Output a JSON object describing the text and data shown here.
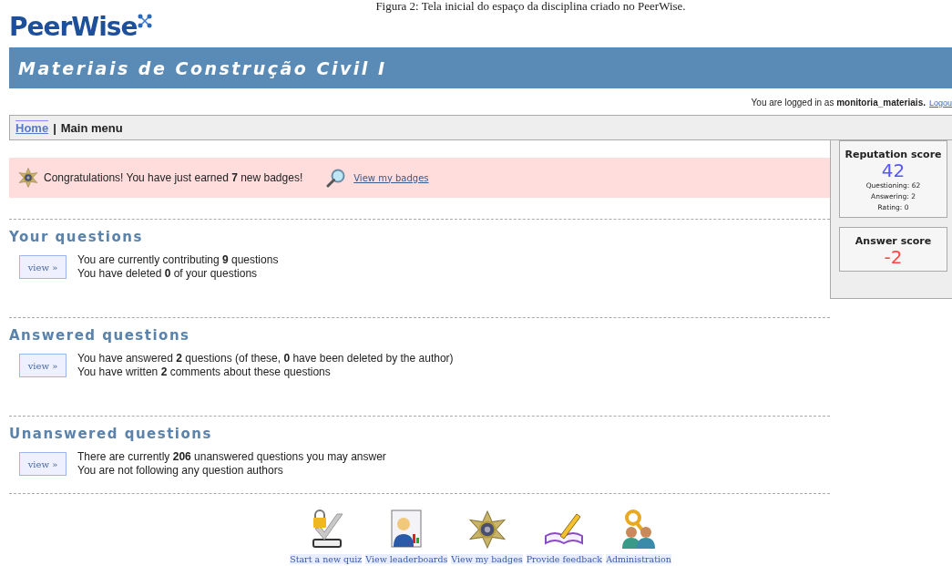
{
  "caption": "Figura 2: Tela inicial do espaço da disciplina criado no PeerWise.",
  "logo": {
    "text": "PeerWise"
  },
  "course_title": "Materiais de Construção Civil I",
  "login": {
    "prefix": "You are logged in as",
    "user": "monitoria_materiais.",
    "logout": "Logou"
  },
  "breadcrumb": {
    "home": "Home",
    "separator": "|",
    "current": "Main menu"
  },
  "notice": {
    "message": "Congratulations! You have just earned **7** new badges!",
    "link": "View my badges"
  },
  "sections": [
    {
      "title": "Your questions",
      "button": "view »",
      "lines": [
        "You are currently contributing **9** questions",
        "You have deleted **0** of your questions"
      ]
    },
    {
      "title": "Answered questions",
      "button": "view »",
      "lines": [
        "You have answered **2** questions (of these, **0** have been deleted by the author)",
        "You have written **2** comments about these questions"
      ]
    },
    {
      "title": "Unanswered questions",
      "button": "view »",
      "lines": [
        "There are currently **206** unanswered questions you may answer",
        "You are not following any question authors"
      ]
    }
  ],
  "scores": [
    {
      "title": "Reputation score",
      "value": "42",
      "color": "#5555ff",
      "details": [
        "Questioning: 62",
        "Answering: 2",
        "Rating: 0"
      ]
    },
    {
      "title": "Answer score",
      "value": "-2",
      "color": "#ff4444"
    }
  ],
  "actions": [
    {
      "kind": "quiz",
      "label": "Start a new quiz"
    },
    {
      "kind": "leaderboard",
      "label": "View leaderboards"
    },
    {
      "kind": "badge",
      "label": "View my badges"
    },
    {
      "kind": "feedback",
      "label": "Provide feedback"
    },
    {
      "kind": "admin",
      "label": "Administration"
    }
  ]
}
